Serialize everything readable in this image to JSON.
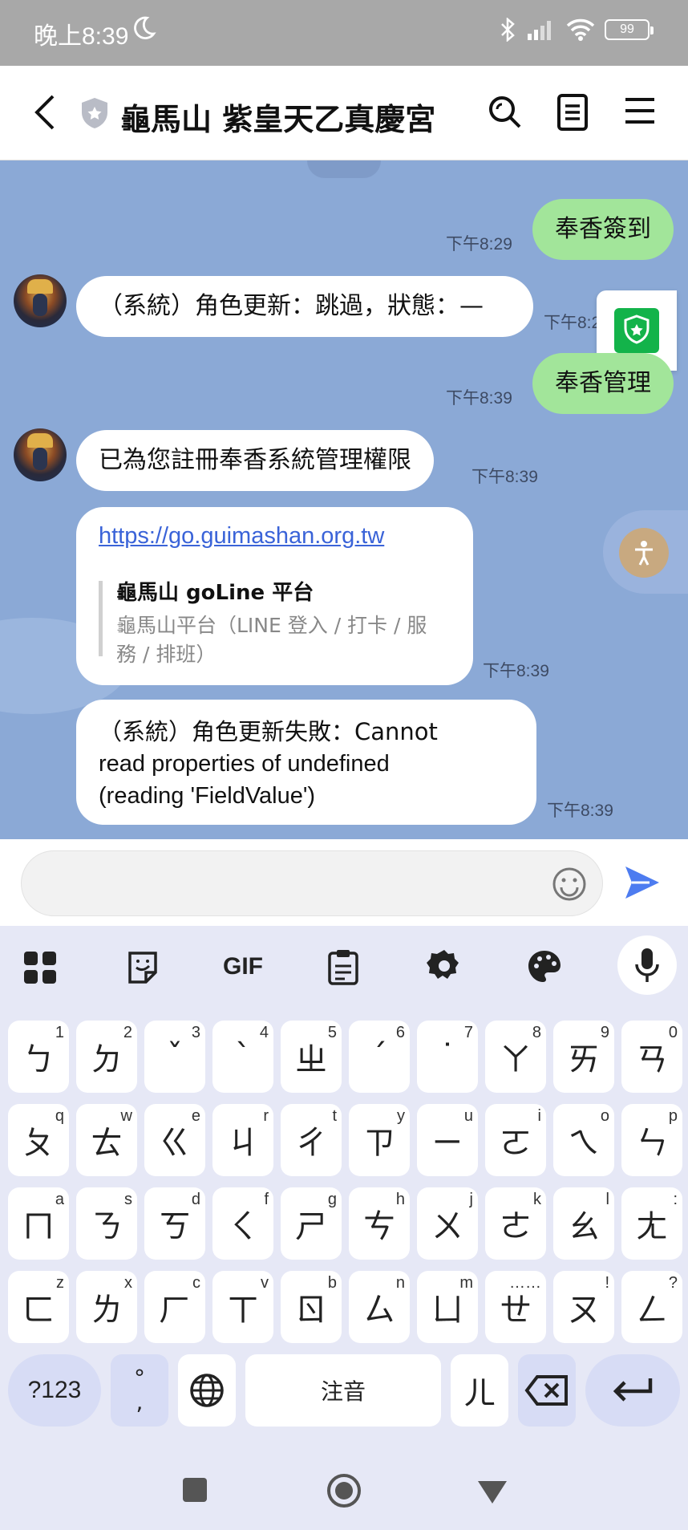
{
  "status_bar": {
    "time": "晚上8:39",
    "battery": "99"
  },
  "header": {
    "title": "龜馬山 紫皇天乙真慶宮"
  },
  "messages": {
    "m1": {
      "text": "奉香簽到",
      "time": "下午8:29"
    },
    "m2": {
      "text": "（系統）角色更新：跳過，狀態：—",
      "time": "下午8:2"
    },
    "m3": {
      "text": "奉香管理",
      "time": "下午8:39"
    },
    "m4": {
      "text": "已為您註冊奉香系統管理權限",
      "time": "下午8:39"
    },
    "m5": {
      "url": "https://go.guimashan.org.tw",
      "preview_title": "龜馬山 goLine 平台",
      "preview_desc_1": "龜馬山平台（LINE 登入 / 打卡 / 服",
      "preview_desc_2": "務 / 排班）",
      "time": "下午8:39"
    },
    "m6": {
      "line1": "（系統）角色更新失敗：Cannot",
      "line2": "read properties of undefined",
      "line3": "(reading 'FieldValue')",
      "time": "下午8:39"
    }
  },
  "input": {
    "placeholder": ""
  },
  "keyboard": {
    "toolbar": {
      "gif": "GIF"
    },
    "rows": [
      [
        {
          "k": "ㄅ",
          "s": "1"
        },
        {
          "k": "ㄉ",
          "s": "2"
        },
        {
          "k": "ˇ",
          "s": "3"
        },
        {
          "k": "ˋ",
          "s": "4"
        },
        {
          "k": "ㄓ",
          "s": "5"
        },
        {
          "k": "ˊ",
          "s": "6"
        },
        {
          "k": "˙",
          "s": "7"
        },
        {
          "k": "ㄚ",
          "s": "8"
        },
        {
          "k": "ㄞ",
          "s": "9"
        },
        {
          "k": "ㄢ",
          "s": "0"
        }
      ],
      [
        {
          "k": "ㄆ",
          "s": "q"
        },
        {
          "k": "ㄊ",
          "s": "w"
        },
        {
          "k": "ㄍ",
          "s": "e"
        },
        {
          "k": "ㄐ",
          "s": "r"
        },
        {
          "k": "ㄔ",
          "s": "t"
        },
        {
          "k": "ㄗ",
          "s": "y"
        },
        {
          "k": "ㄧ",
          "s": "u"
        },
        {
          "k": "ㄛ",
          "s": "i"
        },
        {
          "k": "ㄟ",
          "s": "o"
        },
        {
          "k": "ㄣ",
          "s": "p"
        }
      ],
      [
        {
          "k": "ㄇ",
          "s": "a"
        },
        {
          "k": "ㄋ",
          "s": "s"
        },
        {
          "k": "ㄎ",
          "s": "d"
        },
        {
          "k": "ㄑ",
          "s": "f"
        },
        {
          "k": "ㄕ",
          "s": "g"
        },
        {
          "k": "ㄘ",
          "s": "h"
        },
        {
          "k": "ㄨ",
          "s": "j"
        },
        {
          "k": "ㄜ",
          "s": "k"
        },
        {
          "k": "ㄠ",
          "s": "l"
        },
        {
          "k": "ㄤ",
          "s": ":"
        }
      ],
      [
        {
          "k": "ㄈ",
          "s": "z"
        },
        {
          "k": "ㄌ",
          "s": "x"
        },
        {
          "k": "ㄏ",
          "s": "c"
        },
        {
          "k": "ㄒ",
          "s": "v"
        },
        {
          "k": "ㄖ",
          "s": "b"
        },
        {
          "k": "ㄙ",
          "s": "n"
        },
        {
          "k": "ㄩ",
          "s": "m"
        },
        {
          "k": "ㄝ",
          "s": "……"
        },
        {
          "k": "ㄡ",
          "s": "!"
        },
        {
          "k": "ㄥ",
          "s": "?"
        }
      ]
    ],
    "bottom": {
      "sym": "?123",
      "punct_top": "°",
      "punct_bottom": ",",
      "space": "注音",
      "er": "ㄦ"
    }
  },
  "colors": {
    "chat_bg": "#8ba9d6",
    "sent_bubble": "#a2e59a",
    "link": "#3a63d8",
    "send_icon": "#4d7cf0",
    "badge_green": "#13b34a"
  }
}
